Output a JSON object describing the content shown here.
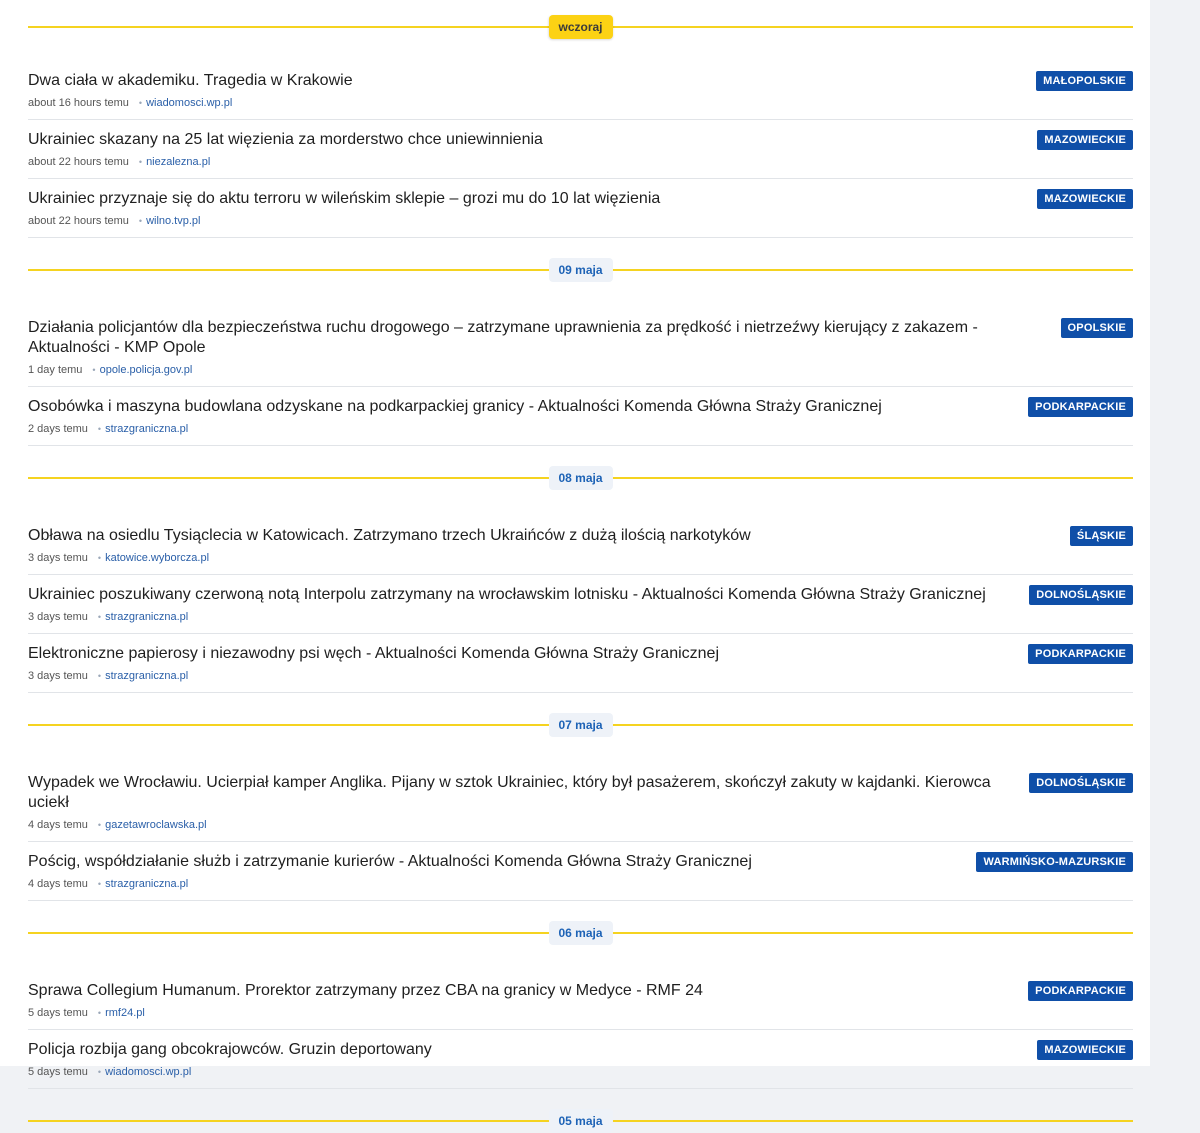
{
  "sections": [
    {
      "date_label": "wczoraj",
      "items": [
        {
          "title": "Dwa ciała w akademiku. Tragedia w Krakowie",
          "time": "about 16 hours temu",
          "source": "wiadomosci.wp.pl",
          "region": "MAŁOPOLSKIE"
        },
        {
          "title": "Ukrainiec skazany na 25 lat więzienia za morderstwo chce uniewinnienia",
          "time": "about 22 hours temu",
          "source": "niezalezna.pl",
          "region": "MAZOWIECKIE"
        },
        {
          "title": "Ukrainiec przyznaje się do aktu terroru w wileńskim sklepie – grozi mu do 10 lat więzienia",
          "time": "about 22 hours temu",
          "source": "wilno.tvp.pl",
          "region": "MAZOWIECKIE"
        }
      ]
    },
    {
      "date_label": "09 maja",
      "items": [
        {
          "title": "Działania policjantów dla bezpieczeństwa ruchu drogowego – zatrzymane uprawnienia za prędkość i nietrzeźwy kierujący z zakazem - Aktualności - KMP Opole",
          "time": "1 day temu",
          "source": "opole.policja.gov.pl",
          "region": "OPOLSKIE"
        },
        {
          "title": "Osobówka i maszyna budowlana odzyskane na podkarpackiej granicy - Aktualności Komenda Główna Straży Granicznej",
          "time": "2 days temu",
          "source": "strazgraniczna.pl",
          "region": "PODKARPACKIE"
        }
      ]
    },
    {
      "date_label": "08 maja",
      "items": [
        {
          "title": "Obława na osiedlu Tysiąclecia w Katowicach. Zatrzymano trzech Ukraińców z dużą ilością narkotyków",
          "time": "3 days temu",
          "source": "katowice.wyborcza.pl",
          "region": "ŚLĄSKIE"
        },
        {
          "title": "Ukrainiec poszukiwany czerwoną notą Interpolu zatrzymany na wrocławskim lotnisku - Aktualności Komenda Główna Straży Granicznej",
          "time": "3 days temu",
          "source": "strazgraniczna.pl",
          "region": "DOLNOŚLĄSKIE"
        },
        {
          "title": "Elektroniczne papierosy i niezawodny psi węch - Aktualności Komenda Główna Straży Granicznej",
          "time": "3 days temu",
          "source": "strazgraniczna.pl",
          "region": "PODKARPACKIE"
        }
      ]
    },
    {
      "date_label": "07 maja",
      "items": [
        {
          "title": "Wypadek we Wrocławiu. Ucierpiał kamper Anglika. Pijany w sztok Ukrainiec, który był pasażerem, skończył zakuty w kajdanki. Kierowca uciekł",
          "time": "4 days temu",
          "source": "gazetawroclawska.pl",
          "region": "DOLNOŚLĄSKIE"
        },
        {
          "title": "Pościg, współdziałanie służb i zatrzymanie kurierów - Aktualności Komenda Główna Straży Granicznej",
          "time": "4 days temu",
          "source": "strazgraniczna.pl",
          "region": "WARMIŃSKO-MAZURSKIE"
        }
      ]
    },
    {
      "date_label": "06 maja",
      "items": [
        {
          "title": "Sprawa Collegium Humanum. Prorektor zatrzymany przez CBA na granicy w Medyce - RMF 24",
          "time": "5 days temu",
          "source": "rmf24.pl",
          "region": "PODKARPACKIE"
        },
        {
          "title": "Policja rozbija gang obcokrajowców. Gruzin deportowany",
          "time": "5 days temu",
          "source": "wiadomosci.wp.pl",
          "region": "MAZOWIECKIE"
        }
      ]
    },
    {
      "date_label": "05 maja",
      "items": []
    }
  ],
  "colors": {
    "accent_line": "#f5d320",
    "today_pill": "#fcd214",
    "badge": "#0f4fa8",
    "source_link": "#2a5fa8"
  }
}
